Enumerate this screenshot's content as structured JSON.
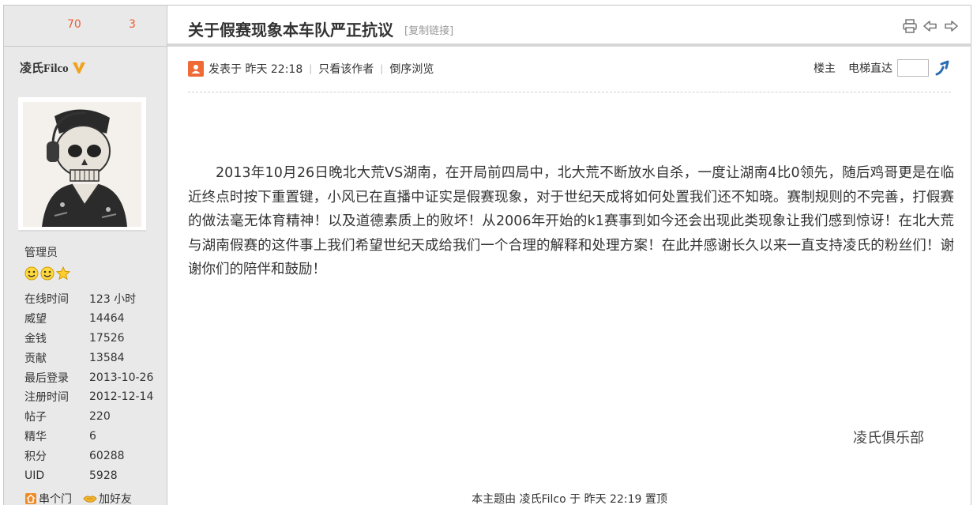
{
  "sidebar": {
    "stat_a": "70",
    "stat_b": "3",
    "username": "凌氏Filco",
    "role": "管理员",
    "stats": [
      {
        "label": "在线时间",
        "value": "123 小时"
      },
      {
        "label": "威望",
        "value": "14464"
      },
      {
        "label": "金钱",
        "value": "17526"
      },
      {
        "label": "贡献",
        "value": "13584"
      },
      {
        "label": "最后登录",
        "value": "2013-10-26"
      },
      {
        "label": "注册时间",
        "value": "2012-12-14"
      },
      {
        "label": "帖子",
        "value": "220"
      },
      {
        "label": "精华",
        "value": "6"
      },
      {
        "label": "积分",
        "value": "60288"
      },
      {
        "label": "UID",
        "value": "5928"
      }
    ],
    "action_visit": "串个门",
    "action_friend": "加好友"
  },
  "thread": {
    "title": "关于假赛现象本车队严正抗议",
    "copy_link": "[复制链接]",
    "posted_at": "发表于 昨天 22:18",
    "only_author": "只看该作者",
    "reverse": "倒序浏览",
    "floor": "楼主",
    "jump_label": "电梯直达",
    "body": "2013年10月26日晚北大荒VS湖南，在开局前四局中，北大荒不断放水自杀，一度让湖南4比0领先，随后鸡哥更是在临近终点时按下重置键，小风已在直播中证实是假赛现象，对于世纪天成将如何处置我们还不知晓。赛制规则的不完善，打假赛的做法毫无体育精神！以及道德素质上的败坏！从2006年开始的k1赛事到如今还会出现此类现象让我们感到惊讶！在北大荒与湖南假赛的这件事上我们希望世纪天成给我们一个合理的解释和处理方案！在此并感谢长久以来一直支持凌氏的粉丝们！谢谢你们的陪伴和鼓励！",
    "signature": "凌氏俱乐部",
    "footnote": "本主题由 凌氏Filco 于 昨天 22:19 置顶"
  },
  "colors": {
    "accent_orange": "#ee5b37",
    "sidebar_bg": "#e9e9e9",
    "jump_blue": "#2a6cb0"
  }
}
